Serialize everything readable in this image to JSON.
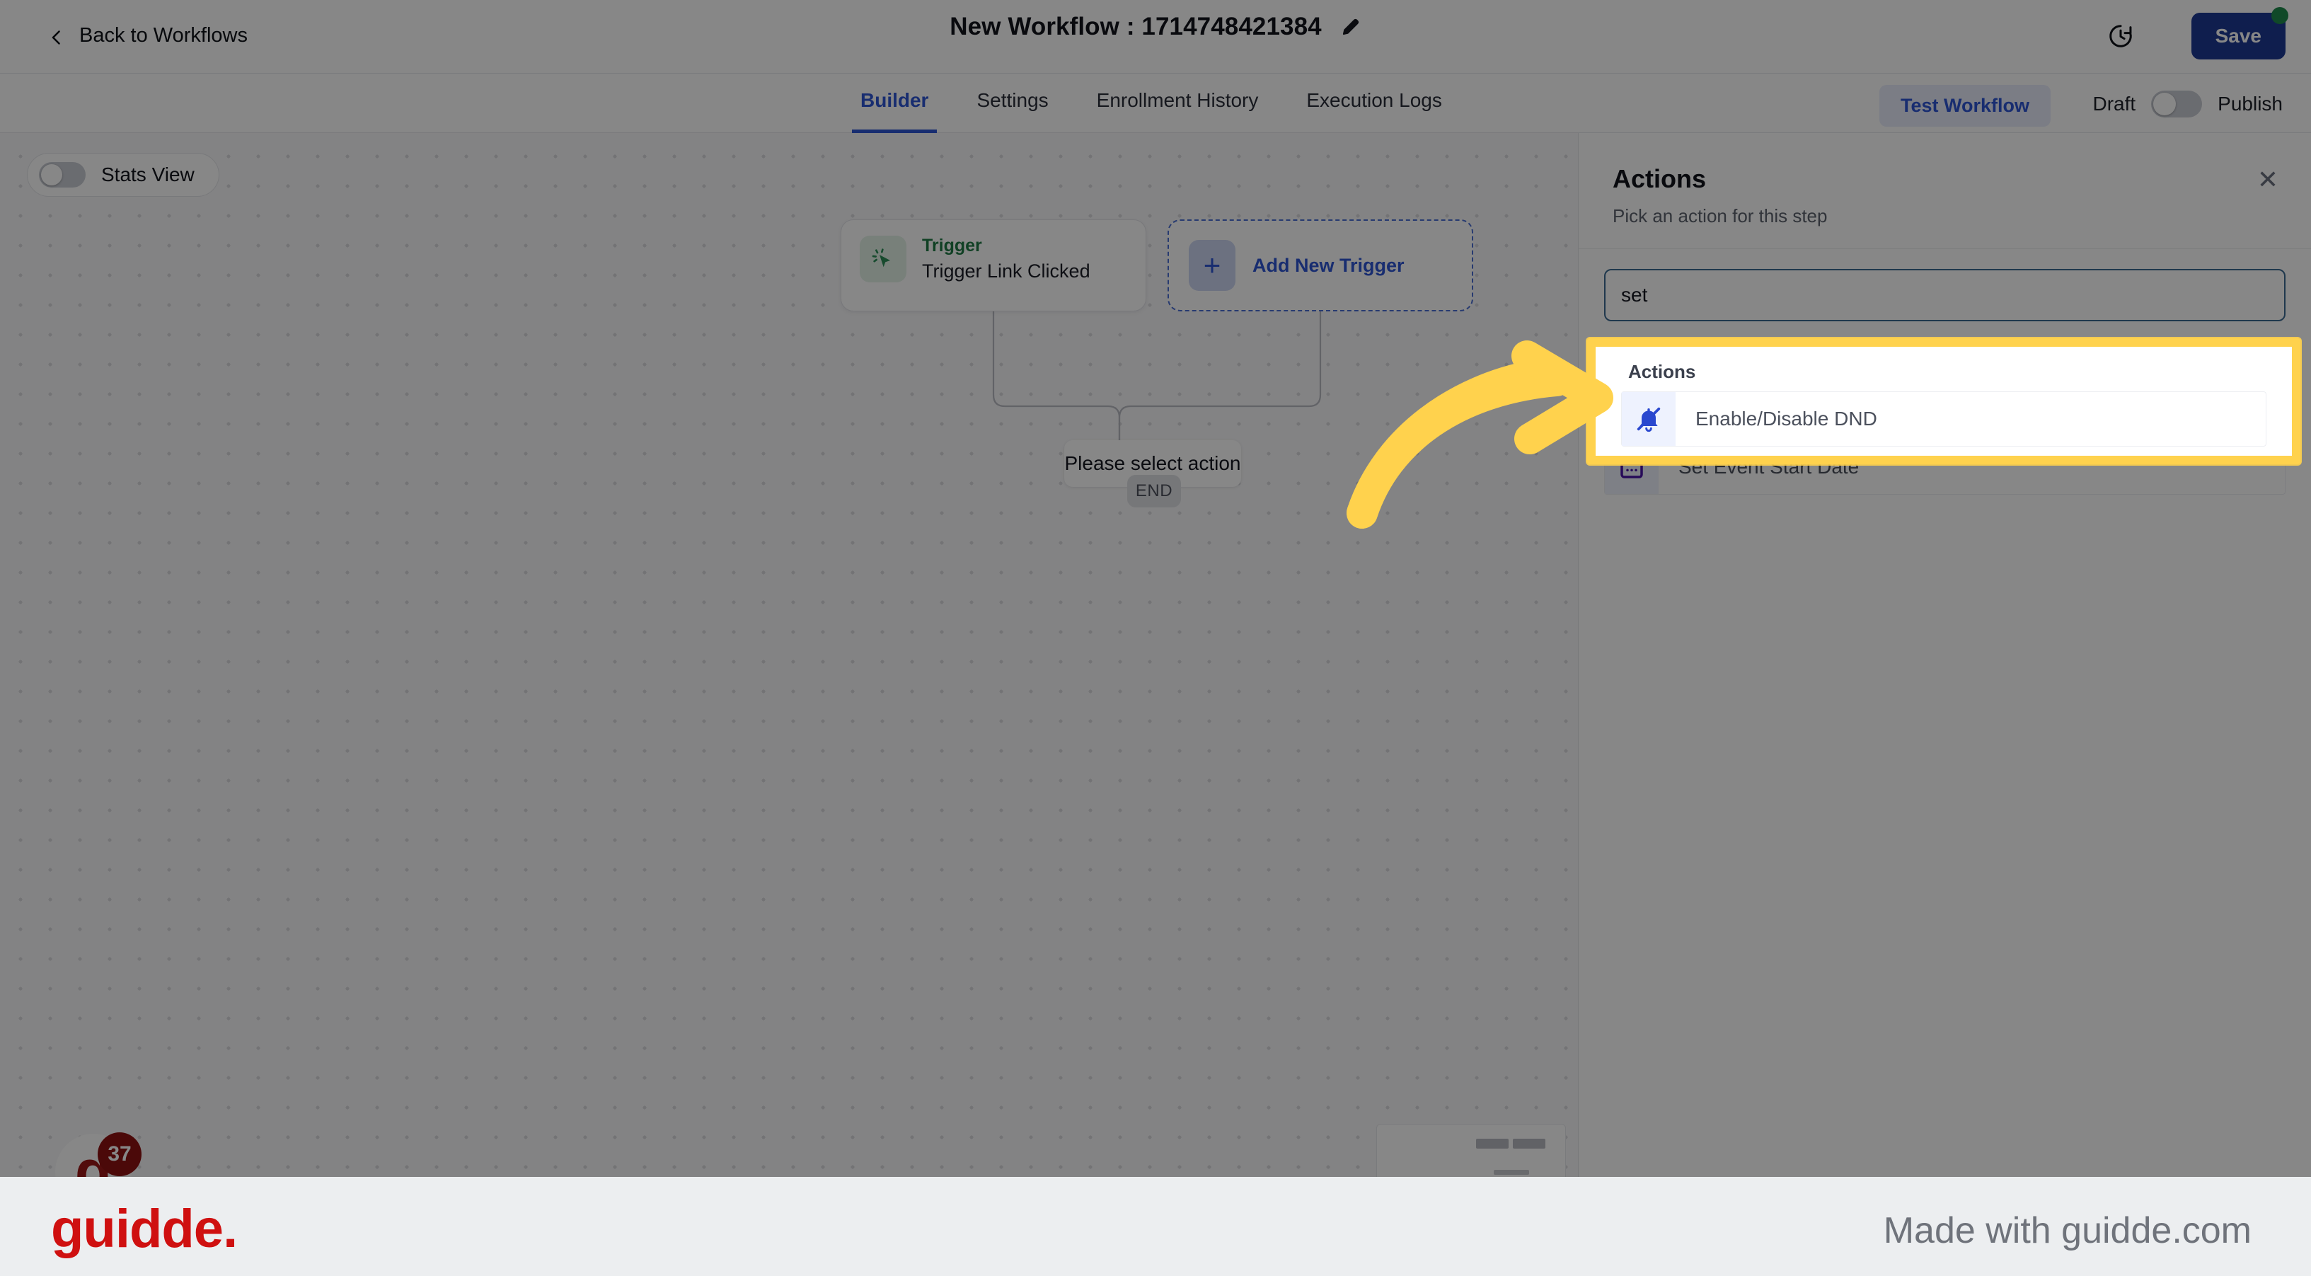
{
  "topbar": {
    "back_label": "Back to Workflows",
    "back_icon": "chevron-left-icon",
    "workflow_title": "New Workflow : 1714748421384",
    "edit_icon": "pencil-icon",
    "history_icon": "history-clock-icon",
    "save_label": "Save",
    "save_color": "#1d3a94",
    "save_badge_color": "#1f8b4c"
  },
  "tabs": {
    "items": [
      {
        "label": "Builder",
        "active": true
      },
      {
        "label": "Settings",
        "active": false
      },
      {
        "label": "Enrollment History",
        "active": false
      },
      {
        "label": "Execution Logs",
        "active": false
      }
    ],
    "test_workflow_label": "Test Workflow",
    "draft_label": "Draft",
    "publish_label": "Publish",
    "publish_toggle_on": false,
    "accent_color": "#2f55d4"
  },
  "canvas": {
    "stats_view_label": "Stats View",
    "stats_view_on": false,
    "trigger_node": {
      "kind_label": "Trigger",
      "name_label": "Trigger Link Clicked",
      "icon": "cursor-click-icon",
      "kind_color": "#1f7a45"
    },
    "add_trigger": {
      "label": "Add New Trigger",
      "icon": "plus-icon"
    },
    "select_action_label": "Please select action",
    "end_label": "END",
    "minimap_name": "canvas-minimap"
  },
  "panel": {
    "title": "Actions",
    "subtitle": "Pick an action for this step",
    "close_icon": "close-icon",
    "search_value": "set",
    "search_placeholder": "",
    "results_header": "Actions",
    "results": [
      {
        "label": "Enable/Disable DND",
        "icon": "bell-off-icon",
        "icon_color": "#2a48cf",
        "highlighted": true
      },
      {
        "label": "Set Event Start Date",
        "icon": "calendar-icon",
        "icon_color": "#4b16a8",
        "highlighted": false
      }
    ]
  },
  "annotation": {
    "highlight_color": "#ffd24d",
    "arrow_color": "#ffd24d",
    "arrow_name": "pointer-arrow"
  },
  "footer": {
    "logo_text": "guidde.",
    "logo_color": "#cf1010",
    "made_with": "Made with guidde.com",
    "badge_count": "37"
  }
}
